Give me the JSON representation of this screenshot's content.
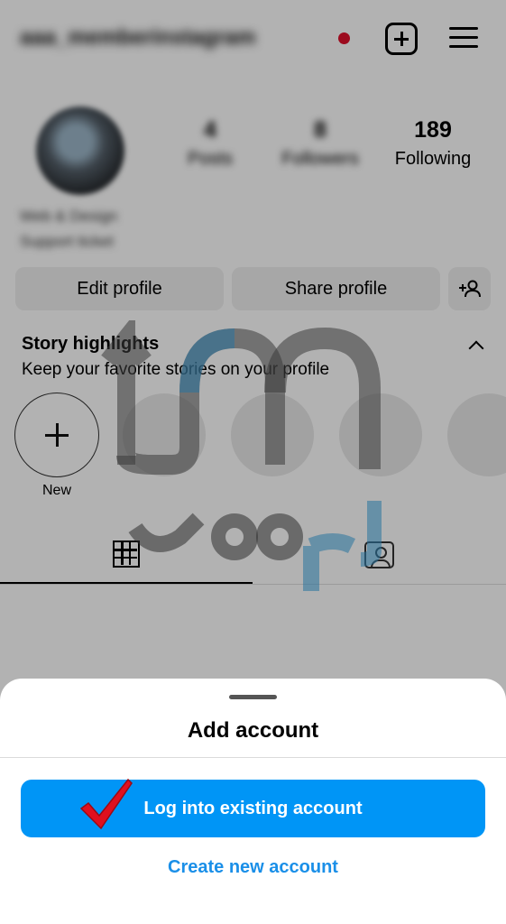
{
  "profile": {
    "username": "aaa_memberinstagram",
    "stats": [
      {
        "value": "4",
        "label": "Posts"
      },
      {
        "value": "8",
        "label": "Followers"
      },
      {
        "value": "189",
        "label": "Following"
      }
    ],
    "bio_lines": [
      "Web & Design",
      "Support ticket"
    ],
    "edit_button": "Edit profile",
    "share_button": "Share profile",
    "highlights_title": "Story highlights",
    "highlights_subtitle": "Keep your favorite stories on your profile",
    "new_highlight_label": "New"
  },
  "sheet": {
    "title": "Add account",
    "login_button": "Log into existing account",
    "create_link": "Create new account"
  },
  "colors": {
    "accent_blue": "#0095f6",
    "link_blue": "#1a8fe8",
    "notification_red": "#e0102b",
    "check_red": "#e0101e"
  },
  "icons": [
    "add-post-icon",
    "menu-icon",
    "add-person-icon",
    "chevron-up-icon",
    "plus-icon",
    "grid-icon",
    "tagged-icon",
    "checkmark-icon"
  ]
}
